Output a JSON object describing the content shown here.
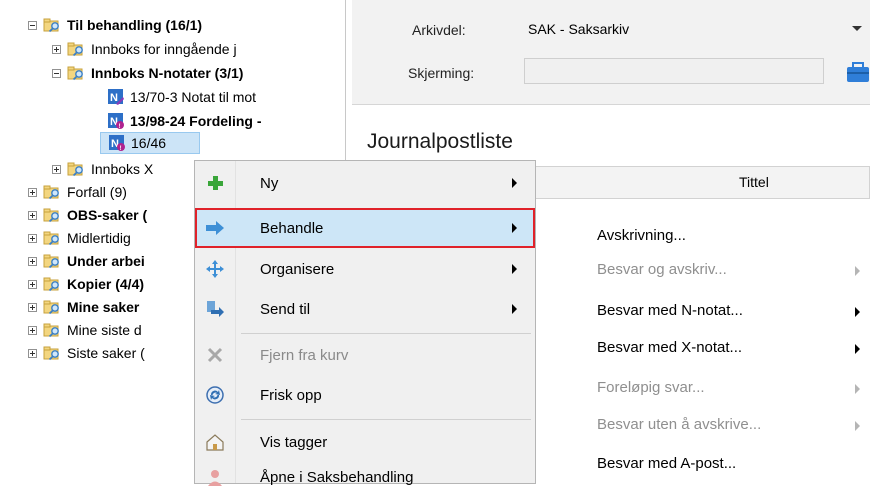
{
  "tree": {
    "items": [
      {
        "label": "Til behandling (16/1)",
        "expander": "minus",
        "icon": "search-folder",
        "bold": true
      },
      {
        "label": "Innboks for inngående j",
        "expander": "plus",
        "icon": "search-folder",
        "bold": false
      },
      {
        "label": "Innboks N-notater (3/1)",
        "expander": "minus",
        "icon": "search-folder",
        "bold": true
      },
      {
        "label": "13/70-3 Notat til mot",
        "expander": "",
        "icon": "note-edit",
        "bold": false
      },
      {
        "label": "13/98-24 Fordeling -",
        "expander": "",
        "icon": "note-unread",
        "bold": true
      },
      {
        "label": "16/46",
        "expander": "",
        "icon": "note-unread",
        "bold": false,
        "selected": true
      },
      {
        "label": "Innboks X",
        "expander": "plus",
        "icon": "search-folder",
        "bold": false
      },
      {
        "label": "Forfall (9)",
        "expander": "plus",
        "icon": "search-folder",
        "bold": false
      },
      {
        "label": "OBS-saker (",
        "expander": "plus",
        "icon": "search-folder",
        "bold": true
      },
      {
        "label": "Midlertidig",
        "expander": "plus",
        "icon": "search-folder",
        "bold": false
      },
      {
        "label": "Under arbei",
        "expander": "plus",
        "icon": "search-folder",
        "bold": true
      },
      {
        "label": "Kopier (4/4)",
        "expander": "plus",
        "icon": "search-folder",
        "bold": true
      },
      {
        "label": "Mine saker",
        "expander": "plus",
        "icon": "search-folder",
        "bold": true
      },
      {
        "label": "Mine siste d",
        "expander": "plus",
        "icon": "search-folder",
        "bold": false
      },
      {
        "label": "Siste saker (",
        "expander": "plus",
        "icon": "search-folder",
        "bold": false
      }
    ]
  },
  "header": {
    "arkivdel_label": "Arkivdel:",
    "arkivdel_value": "SAK - Saksarkiv",
    "skjerming_label": "Skjerming:",
    "skjerming_value": ""
  },
  "journal": {
    "title": "Journalpostliste",
    "column_title": "Tittel"
  },
  "context_menu": {
    "items": [
      {
        "label": "Ny",
        "icon": "plus-icon",
        "submenu": true,
        "disabled": false
      },
      {
        "label": "Behandle",
        "icon": "arrow-right-icon",
        "submenu": true,
        "disabled": false,
        "highlighted": true
      },
      {
        "label": "Organisere",
        "icon": "move-icon",
        "submenu": true,
        "disabled": false
      },
      {
        "label": "Send til",
        "icon": "send-icon",
        "submenu": true,
        "disabled": false
      },
      {
        "label": "Fjern fra kurv",
        "icon": "remove-icon",
        "submenu": false,
        "disabled": true
      },
      {
        "label": "Frisk opp",
        "icon": "refresh-icon",
        "submenu": false,
        "disabled": false
      },
      {
        "label": "Vis tagger",
        "icon": "tag-house-icon",
        "submenu": false,
        "disabled": false
      },
      {
        "label": "Åpne i Saksbehandling",
        "icon": "person-icon",
        "submenu": false,
        "disabled": false
      }
    ]
  },
  "submenu": {
    "items": [
      {
        "label": "Avskrivning...",
        "submenu": false,
        "disabled": false
      },
      {
        "label": "Besvar og avskriv...",
        "submenu": true,
        "disabled": true
      },
      {
        "label": "Besvar med N-notat...",
        "submenu": true,
        "disabled": false
      },
      {
        "label": "Besvar med X-notat...",
        "submenu": true,
        "disabled": false
      },
      {
        "label": "Foreløpig svar...",
        "submenu": true,
        "disabled": true
      },
      {
        "label": "Besvar uten å avskrive...",
        "submenu": true,
        "disabled": true
      },
      {
        "label": "Besvar med A-post...",
        "submenu": false,
        "disabled": false
      }
    ]
  },
  "colors": {
    "highlight_outline": "#e0222a",
    "selection_bg": "#cde6f7",
    "disabled_text": "#8a8a8a"
  }
}
